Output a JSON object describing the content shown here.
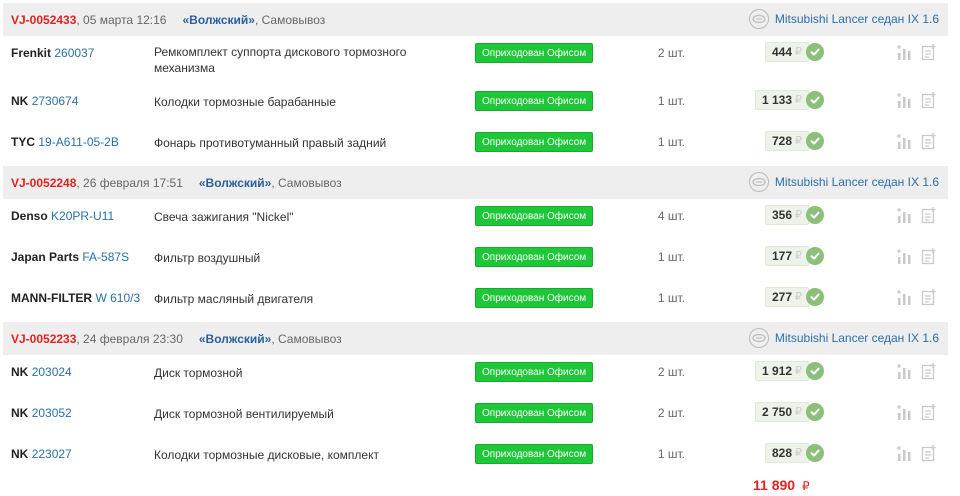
{
  "colors": {
    "order_id": "#e02222",
    "store_link": "#2b5f9a",
    "link": "#2a6fa8",
    "status_badge": "#1ec738",
    "row_header_bg": "#eeeeee",
    "ok_icon": "#8cc07a"
  },
  "currency_symbol": "₽",
  "orders": [
    {
      "id": "VJ-0052433",
      "date": ", 05 марта 12:16",
      "store": "«Волжский»",
      "delivery": ", Самовывоз",
      "car": "Mitsubishi Lancer седан IX 1.6",
      "items": [
        {
          "brand": "Frenkit",
          "article": "260037",
          "description": "Ремкомплект суппорта дискового тормозного механизма",
          "status": "Оприходован Офисом",
          "qty": "2 шт.",
          "price": "444"
        },
        {
          "brand": "NK",
          "article": "2730674",
          "description": "Колодки тормозные барабанные",
          "status": "Оприходован Офисом",
          "qty": "1 шт.",
          "price": "1 133"
        },
        {
          "brand": "TYC",
          "article": "19-A611-05-2B",
          "description": "Фонарь противотуманный правый задний",
          "status": "Оприходован Офисом",
          "qty": "1 шт.",
          "price": "728"
        }
      ]
    },
    {
      "id": "VJ-0052248",
      "date": ", 26 февраля 17:51",
      "store": "«Волжский»",
      "delivery": ", Самовывоз",
      "car": "Mitsubishi Lancer седан IX 1.6",
      "items": [
        {
          "brand": "Denso",
          "article": "K20PR-U11",
          "description": "Свеча зажигания \"Nickel\"",
          "status": "Оприходован Офисом",
          "qty": "4 шт.",
          "price": "356"
        },
        {
          "brand": "Japan Parts",
          "article": "FA-587S",
          "description": "Фильтр воздушный",
          "status": "Оприходован Офисом",
          "qty": "1 шт.",
          "price": "177"
        },
        {
          "brand": "MANN-FILTER",
          "article": "W 610/3",
          "description": "Фильтр масляный двигателя",
          "status": "Оприходован Офисом",
          "qty": "1 шт.",
          "price": "277"
        }
      ]
    },
    {
      "id": "VJ-0052233",
      "date": ", 24 февраля 23:30",
      "store": "«Волжский»",
      "delivery": ", Самовывоз",
      "car": "Mitsubishi Lancer седан IX 1.6",
      "items": [
        {
          "brand": "NK",
          "article": "203024",
          "description": "Диск тормозной",
          "status": "Оприходован Офисом",
          "qty": "2 шт.",
          "price": "1 912"
        },
        {
          "brand": "NK",
          "article": "203052",
          "description": "Диск тормозной вентилируемый",
          "status": "Оприходован Офисом",
          "qty": "2 шт.",
          "price": "2 750"
        },
        {
          "brand": "NK",
          "article": "223027",
          "description": "Колодки тормозные дисковые, комплект",
          "status": "Оприходован Офисом",
          "qty": "1 шт.",
          "price": "828"
        }
      ]
    }
  ],
  "total": "11 890"
}
